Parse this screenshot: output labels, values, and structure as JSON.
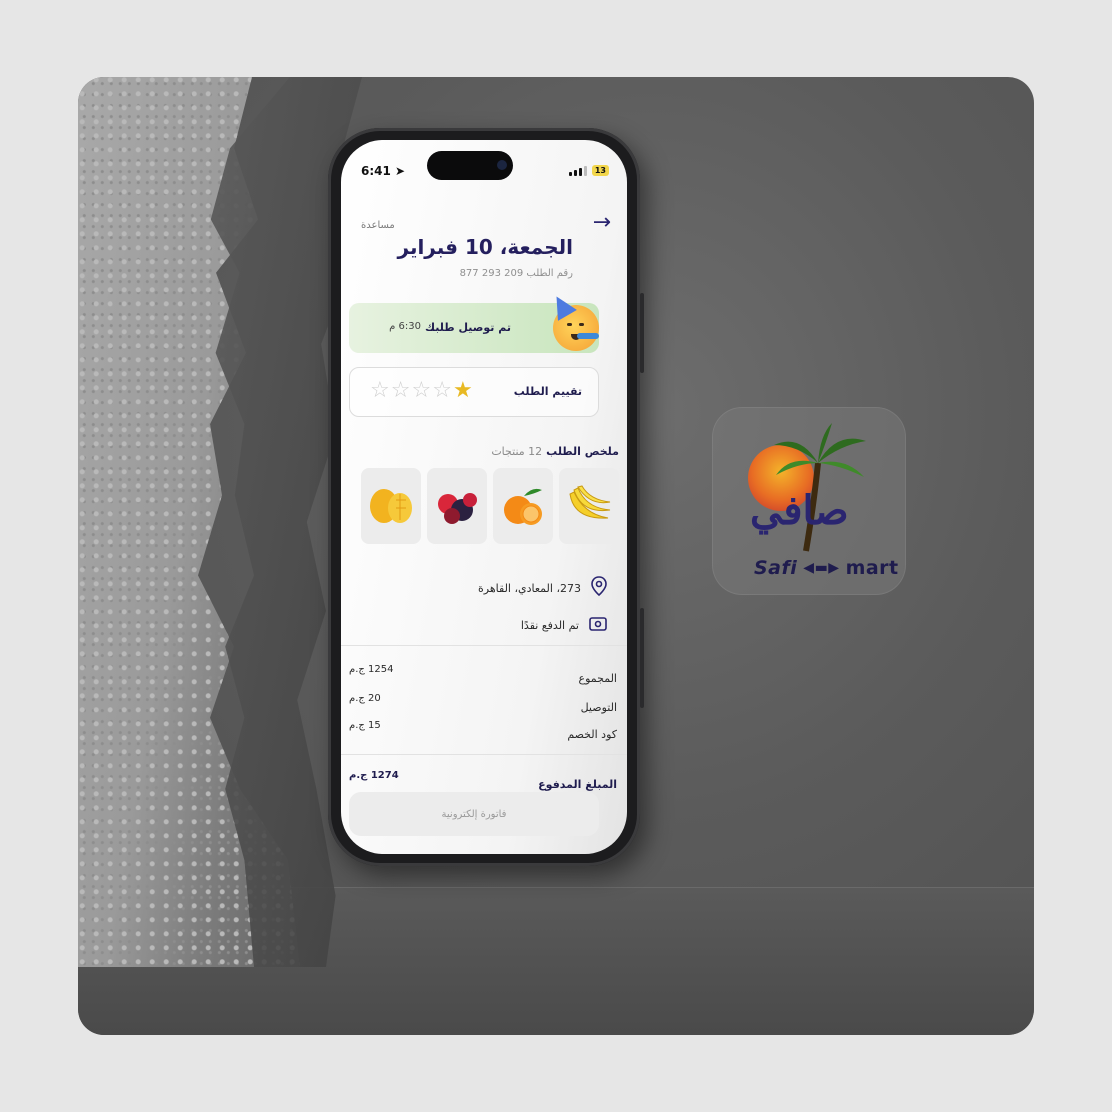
{
  "status_bar": {
    "time": "6:41",
    "battery": "13"
  },
  "header": {
    "help": "مساعدة",
    "back_icon": "arrow-right-icon",
    "title": "الجمعة، 10 فبراير",
    "order_number": "رقم الطلب 209 293 877"
  },
  "delivery": {
    "text": "تم توصيل طلبك",
    "time": "6:30 م",
    "icon": "party-face-icon"
  },
  "rating": {
    "label": "تقييم الطلب",
    "value": 1,
    "max": 5,
    "star_color": "#e8b923"
  },
  "summary": {
    "label": "ملخص الطلب",
    "count": "12 منتجات",
    "products": [
      "bananas",
      "oranges",
      "berries",
      "mangoes"
    ]
  },
  "address": {
    "icon": "location-pin-icon",
    "text": "273، المعادي، القاهرة"
  },
  "payment": {
    "icon": "cash-icon",
    "text": "تم الدفع نقدًا"
  },
  "totals": {
    "subtotal_label": "المجموع",
    "subtotal": "1254 ج.م",
    "delivery_label": "التوصيل",
    "delivery": "20 ج.م",
    "discount_label": "كود الخصم",
    "discount": "15 ج.م",
    "paid_label": "المبلغ المدفوع",
    "paid": "1274 ج.م"
  },
  "invoice_button": "فاتورة إلكترونية",
  "brand": {
    "arabic": "صافي",
    "latin_left": "Safi",
    "latin_right": "mart",
    "primary_color": "#241f5e"
  }
}
